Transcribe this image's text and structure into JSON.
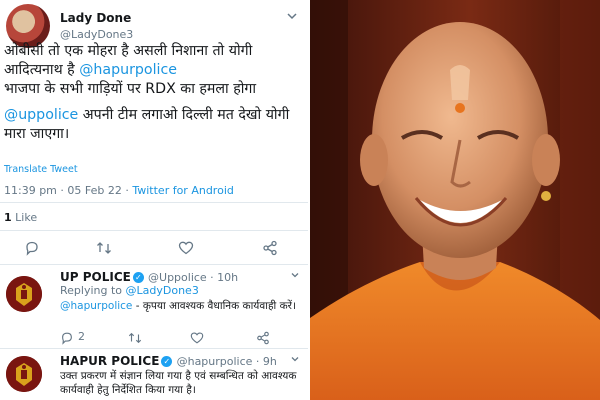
{
  "tweet": {
    "author_name": "Lady Done",
    "author_handle": "@LadyDone3",
    "text_line1": "ओबीसी तो एक मोहरा है असली निशाना तो योगी आदित्यनाथ है ",
    "mention1": "@hapurpolice",
    "text_line2": "भाजपा के सभी गाड़ियों पर RDX का हमला होगा",
    "mention2": "@uppolice",
    "text_line3": " अपनी टीम लगाओ दिल्ली मत देखो योगी मारा जाएगा।",
    "translate_label": "Translate Tweet",
    "timestamp": "11:39 pm · 05 Feb 22 · ",
    "client": "Twitter for Android",
    "likes_count": "1",
    "likes_label": "Like"
  },
  "replies": [
    {
      "name": "UP POLICE",
      "handle": "@Uppolice · 10h",
      "replying_prefix": "Replying to ",
      "replying_to": "@LadyDone3",
      "mention": "@hapurpolice",
      "text": " - कृपया आवश्यक वैधानिक कार्यवाही करें।",
      "reply_count": "2"
    },
    {
      "name": "HAPUR POLICE",
      "handle": "@hapurpolice · 9h",
      "text": "उक्त प्रकरण में संज्ञान लिया गया है एवं सम्बन्धित को आवश्यक कार्यवाही हेतु निर्देशित किया गया है।"
    }
  ],
  "icons": [
    "chevron-down-icon",
    "reply-icon",
    "retweet-icon",
    "like-icon",
    "share-icon",
    "verified-icon"
  ],
  "colors": {
    "link": "#1b95e0",
    "muted": "#657786",
    "verified": "#1da1f2",
    "robe": "#e8741e"
  }
}
